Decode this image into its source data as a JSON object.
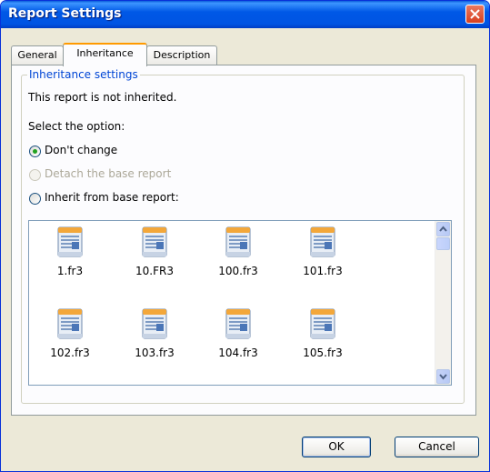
{
  "window": {
    "title": "Report Settings"
  },
  "tabs": [
    {
      "label": "General",
      "active": false
    },
    {
      "label": "Inheritance",
      "active": true
    },
    {
      "label": "Description",
      "active": false
    }
  ],
  "inheritance": {
    "group_title": "Inheritance settings",
    "status_text": "This report is not inherited.",
    "select_label": "Select the option:",
    "options": [
      {
        "label": "Don't change",
        "checked": true,
        "enabled": true
      },
      {
        "label": "Detach the base report",
        "checked": false,
        "enabled": false
      },
      {
        "label": "Inherit from base report:",
        "checked": false,
        "enabled": true
      }
    ],
    "files": [
      "1.fr3",
      "10.FR3",
      "100.fr3",
      "101.fr3",
      "102.fr3",
      "103.fr3",
      "104.fr3",
      "105.fr3"
    ]
  },
  "buttons": {
    "ok": "OK",
    "cancel": "Cancel"
  },
  "colors": {
    "title_bar": "#0054e3",
    "group_title": "#0046d5",
    "tab_highlight": "#ff9a00"
  }
}
